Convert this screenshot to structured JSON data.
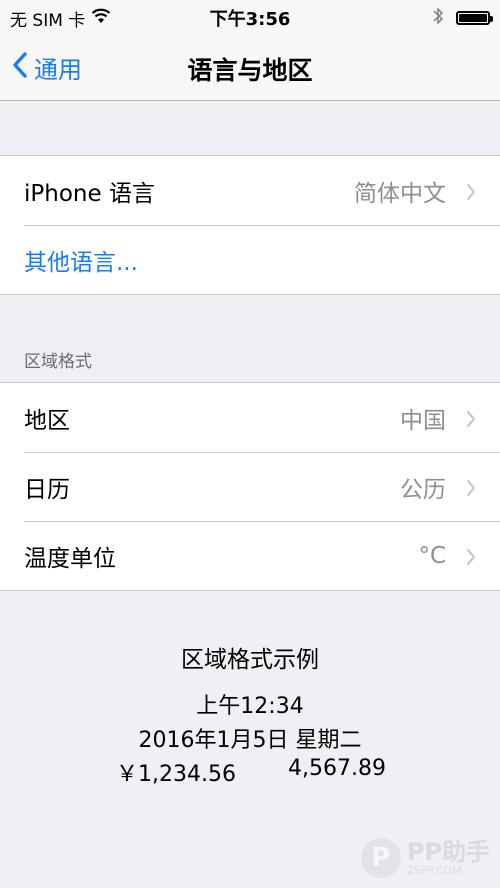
{
  "status_bar": {
    "carrier": "无 SIM 卡",
    "time": "下午3:56"
  },
  "nav": {
    "back_label": "通用",
    "title": "语言与地区"
  },
  "language_group": {
    "iphone_language_label": "iPhone 语言",
    "iphone_language_value": "简体中文",
    "other_languages_label": "其他语言..."
  },
  "region_section": {
    "header": "区域格式",
    "rows": [
      {
        "label": "地区",
        "value": "中国"
      },
      {
        "label": "日历",
        "value": "公历"
      },
      {
        "label": "温度单位",
        "value": "°C"
      }
    ]
  },
  "format_example": {
    "title": "区域格式示例",
    "time": "上午12:34",
    "date": "2016年1月5日 星期二",
    "currency": "￥1,234.56",
    "number": "4,567.89"
  },
  "watermark": {
    "brand": "PP助手",
    "sub": "25PP.COM"
  }
}
